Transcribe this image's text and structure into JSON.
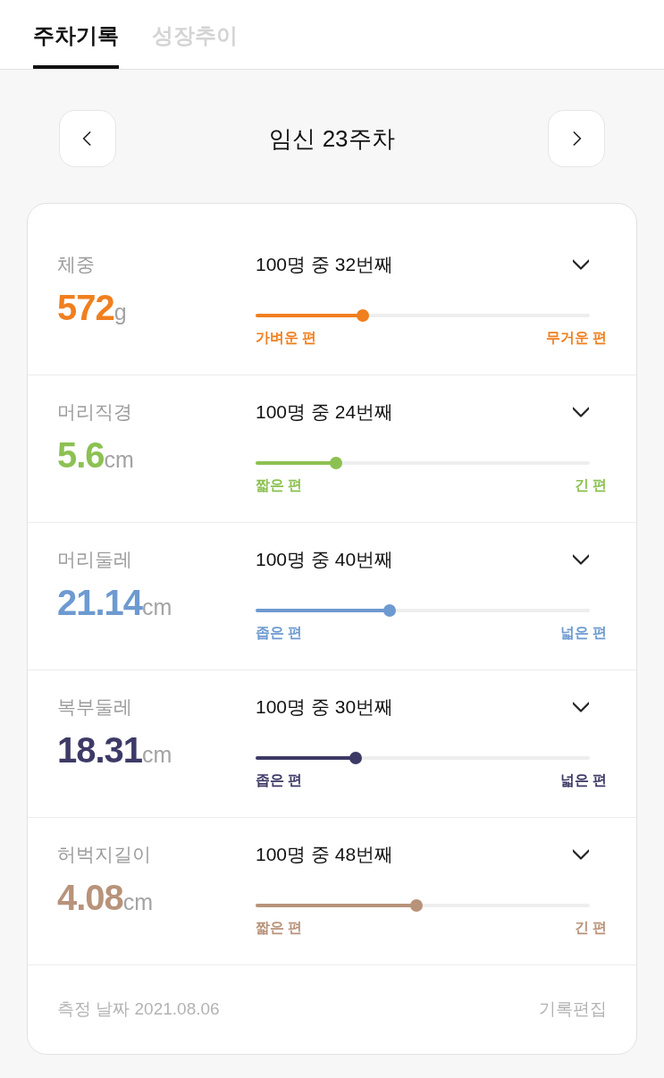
{
  "tabs": [
    {
      "label": "주차기록",
      "selected": true
    },
    {
      "label": "성장추이",
      "selected": false
    }
  ],
  "week_nav": {
    "title": "임신 23주차"
  },
  "measurements": [
    {
      "label": "체중",
      "value": "572",
      "unit": "g",
      "rank": "100명 중 32번째",
      "expanded": false,
      "level": 0.32,
      "low_label": "가벼운 편",
      "high_label": "무거운 편",
      "color": "#f07f1e"
    },
    {
      "label": "머리직경",
      "value": "5.6",
      "unit": "cm",
      "rank": "100명 중 24번째",
      "expanded": false,
      "level": 0.24,
      "low_label": "짧은 편",
      "high_label": "긴 편",
      "color": "#8cc152"
    },
    {
      "label": "머리둘레",
      "value": "21.14",
      "unit": "cm",
      "rank": "100명 중 40번째",
      "expanded": false,
      "level": 0.4,
      "low_label": "좁은 편",
      "high_label": "넓은 편",
      "color": "#6d9ad0"
    },
    {
      "label": "복부둘레",
      "value": "18.31",
      "unit": "cm",
      "rank": "100명 중 30번째",
      "expanded": false,
      "level": 0.3,
      "low_label": "좁은 편",
      "high_label": "넓은 편",
      "color": "#3d3a66"
    },
    {
      "label": "허벅지길이",
      "value": "4.08",
      "unit": "cm",
      "rank": "100명 중 48번째",
      "expanded": false,
      "level": 0.48,
      "low_label": "짧은 편",
      "high_label": "긴 편",
      "color": "#b8937a"
    }
  ],
  "footer": {
    "date": "측정 날짜 2021.08.06",
    "edit": "기록편집"
  }
}
